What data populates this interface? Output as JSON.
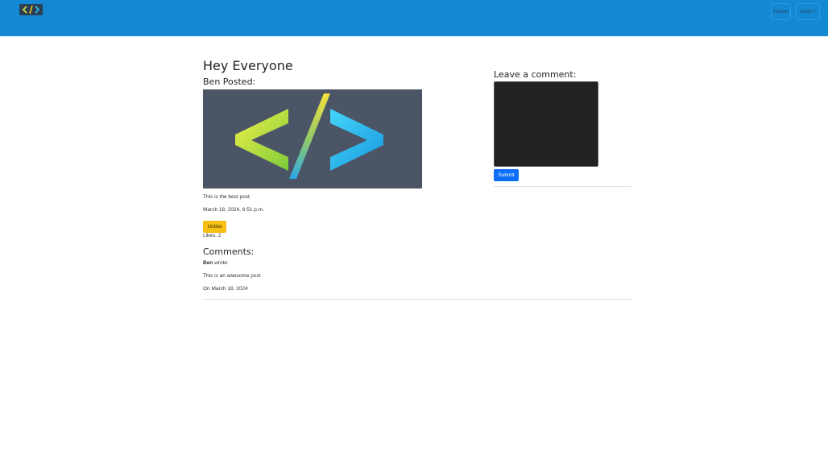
{
  "navbar": {
    "brand_icon": "code-brackets-logo",
    "home_label": "Home",
    "user_label": "Andy",
    "color": "#1488d2"
  },
  "post": {
    "title": "Hey Everyone",
    "author_line": "Ben Posted:",
    "image_icon": "code-brackets-logo",
    "body": "This is the best post.",
    "timestamp": "March 18, 2024, 6:51 p.m.",
    "unlike_label": "Unlike",
    "likes_text": "Likes: 2"
  },
  "comments": {
    "heading": "Comments:",
    "items": [
      {
        "author": "Ben",
        "wrote": "wrote:",
        "text": "This is an awesome post",
        "date": "On March 18, 2024"
      }
    ]
  },
  "comment_form": {
    "heading": "Leave a comment:",
    "textarea_value": "",
    "submit_label": "Submit"
  },
  "colors": {
    "primary": "#0d6efd",
    "warning": "#f7c014",
    "image_bg": "#4b5565"
  }
}
